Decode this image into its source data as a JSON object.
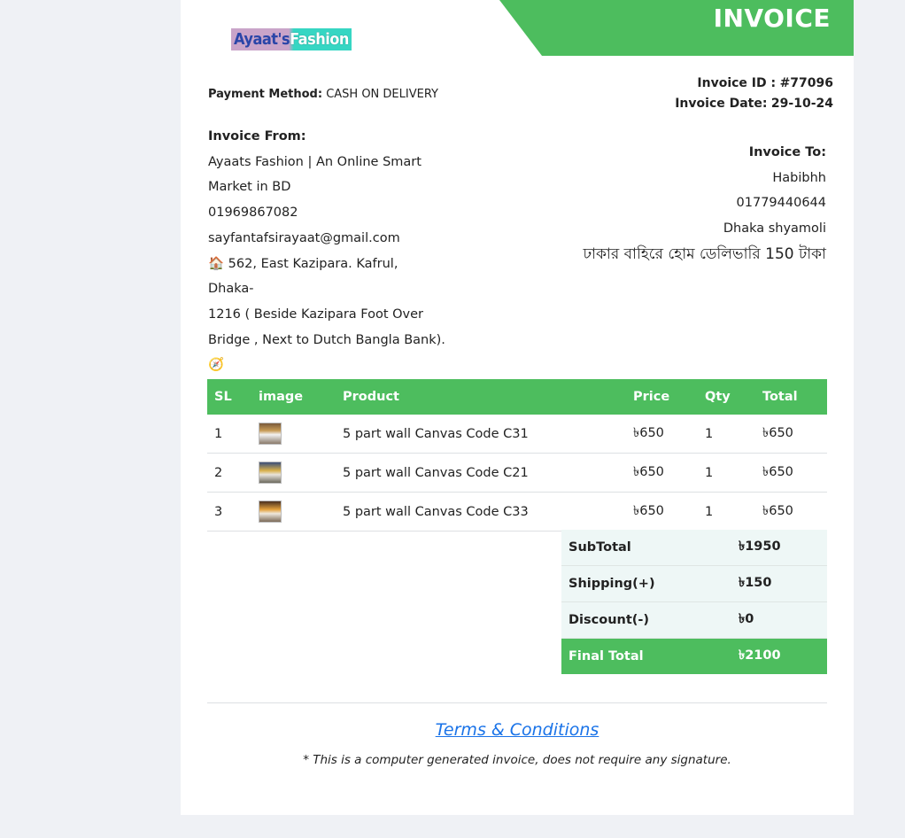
{
  "header": {
    "title": "INVOICE",
    "logo_part1": "Ayaat's",
    "logo_part2": "Fashion"
  },
  "payment": {
    "label": "Payment Method:",
    "value": "CASH ON DELIVERY"
  },
  "invoice": {
    "id_label": "Invoice ID :",
    "id_value": "#77096",
    "date_label": "Invoice Date:",
    "date_value": "29-10-24"
  },
  "from": {
    "heading": "Invoice From:",
    "company_line1": "Ayaats Fashion | An Online Smart",
    "company_line2": "Market in BD",
    "phone": "01969867082",
    "email": "sayfantafsirayaat@gmail.com",
    "address_line1": "562, East Kazipara. Kafrul, Dhaka-",
    "address_line2": "1216 ( Beside Kazipara Foot Over",
    "address_line3": "Bridge , Next to Dutch Bangla Bank).",
    "house_icon": "🏠",
    "compass_icon": "🧭"
  },
  "to": {
    "heading": "Invoice To:",
    "name": "Habibhh",
    "phone": "01779440644",
    "address": "Dhaka shyamoli",
    "note": "ঢাকার বাহিরে হোম ডেলিভারি 150 টাকা"
  },
  "table": {
    "columns": [
      "SL",
      "image",
      "Product",
      "Price",
      "Qty",
      "Total"
    ],
    "rows": [
      {
        "sl": "1",
        "product": "5 part wall Canvas Code C31",
        "price": "৳650",
        "qty": "1",
        "total": "৳650"
      },
      {
        "sl": "2",
        "product": "5 part wall Canvas Code C21",
        "price": "৳650",
        "qty": "1",
        "total": "৳650"
      },
      {
        "sl": "3",
        "product": "5 part wall Canvas Code C33",
        "price": "৳650",
        "qty": "1",
        "total": "৳650"
      }
    ]
  },
  "totals": {
    "subtotal_label": "SubTotal",
    "subtotal_value": "৳1950",
    "shipping_label": "Shipping(+)",
    "shipping_value": "৳150",
    "discount_label": "Discount(-)",
    "discount_value": "৳0",
    "final_label": "Final Total",
    "final_value": "৳2100"
  },
  "footer": {
    "terms": "Terms & Conditions",
    "note": "* This is a computer generated invoice, does not require any signature."
  },
  "colors": {
    "accent": "#4dbd5e",
    "link": "#1a73e8",
    "totals_bg": "#eef7f6"
  }
}
